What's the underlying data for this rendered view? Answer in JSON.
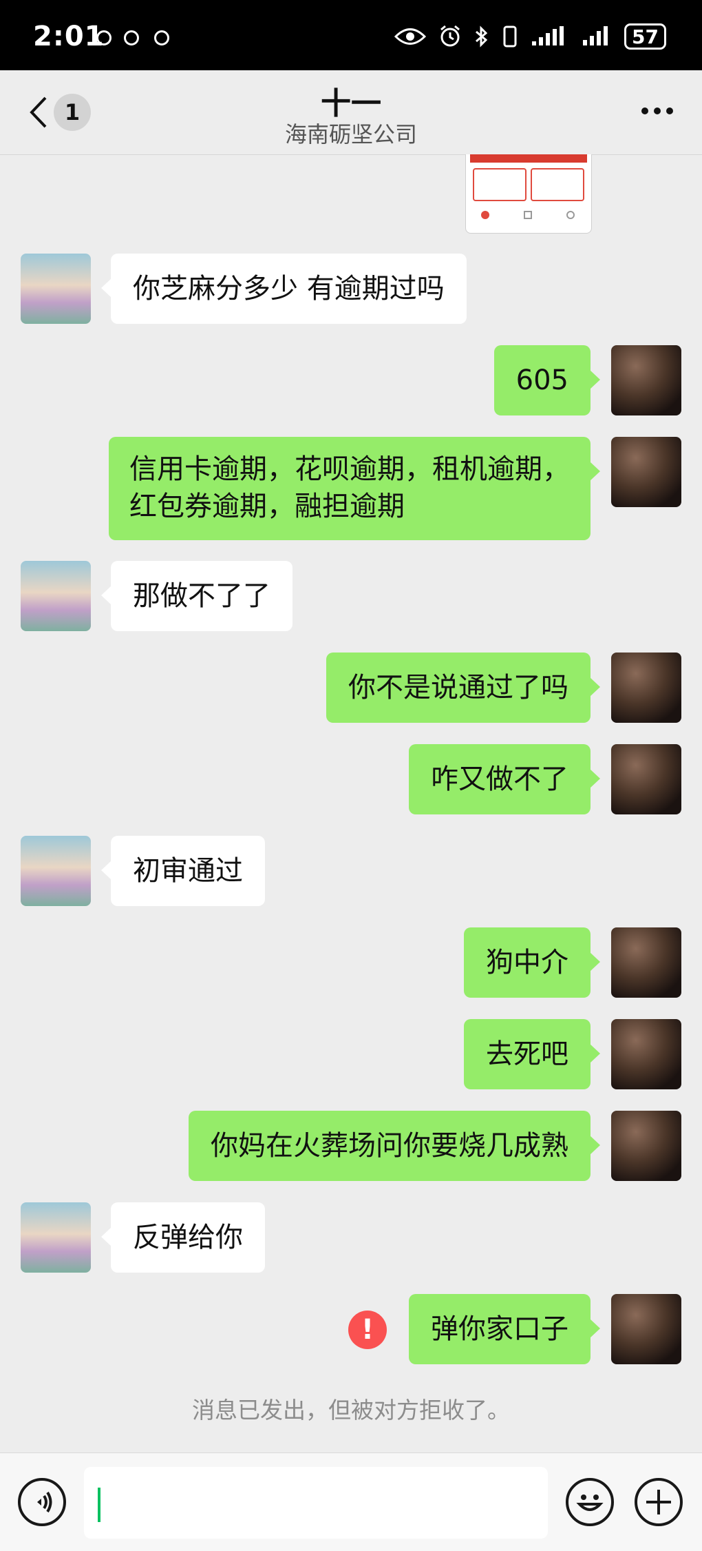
{
  "status_bar": {
    "time": "2:01",
    "battery": "57"
  },
  "header": {
    "unread_count": "1",
    "title": "十一",
    "subtitle": "海南砺坚公司"
  },
  "messages": [
    {
      "side": "left",
      "text": "你芝麻分多少 有逾期过吗"
    },
    {
      "side": "right",
      "text": "605"
    },
    {
      "side": "right",
      "lines": [
        "信用卡逾期，花呗逾期，租机逾期，",
        "红包券逾期，融担逾期"
      ]
    },
    {
      "side": "left",
      "text": "那做不了了"
    },
    {
      "side": "right",
      "text": "你不是说通过了吗"
    },
    {
      "side": "right",
      "text": "咋又做不了"
    },
    {
      "side": "left",
      "text": "初审通过"
    },
    {
      "side": "right",
      "text": "狗中介"
    },
    {
      "side": "right",
      "text": "去死吧"
    },
    {
      "side": "right",
      "text": "你妈在火葬场问你要烧几成熟"
    },
    {
      "side": "left",
      "text": "反弹给你"
    },
    {
      "side": "right",
      "text": "弹你家口子",
      "failed": true
    }
  ],
  "system_notice": "消息已发出，但被对方拒收了。",
  "input": {
    "value": ""
  },
  "colors": {
    "my_bubble": "#95ec69",
    "friend_bubble": "#ffffff",
    "error": "#fa5151",
    "caret": "#07c160"
  },
  "icons": [
    "eye-icon",
    "alarm-icon",
    "bluetooth-icon",
    "vibrate-icon",
    "signal-icon",
    "battery-icon",
    "back-icon",
    "more-icon",
    "voice-icon",
    "emoji-icon",
    "plus-icon",
    "error-icon"
  ]
}
